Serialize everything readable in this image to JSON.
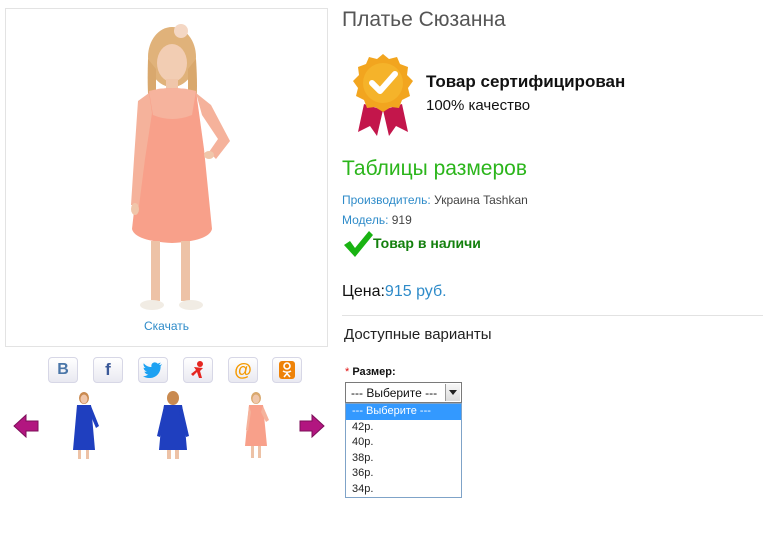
{
  "product": {
    "title": "Платье Сюзанна",
    "download_label": "Скачать"
  },
  "certificate": {
    "title": "Товар сертифицирован",
    "subtitle": "100% качество"
  },
  "size_tables_label": "Таблицы размеров",
  "meta": {
    "manufacturer_key": "Производитель:",
    "manufacturer_value": "Украина Tashkan",
    "model_key": "Модель:",
    "model_value": "919"
  },
  "stock_label": "Товар в наличи",
  "price": {
    "label": "Цена:",
    "value": "915 руб."
  },
  "variants": {
    "title": "Доступные варианты",
    "size_required_mark": "*",
    "size_label": "Размер:",
    "selected": "--- Выберите ---",
    "options": [
      "--- Выберите ---",
      "42р.",
      "40р.",
      "38р.",
      "36р.",
      "34р."
    ]
  },
  "social": [
    {
      "icon": "vk-icon",
      "glyph": "B",
      "color": "#4a76a8"
    },
    {
      "icon": "facebook-icon",
      "glyph": "f",
      "color": "#3b5998"
    },
    {
      "icon": "twitter-icon",
      "glyph": "🐦",
      "color": "#1da1f2"
    },
    {
      "icon": "yaru-icon",
      "glyph": "Я",
      "color": "#e52620"
    },
    {
      "icon": "mailru-icon",
      "glyph": "@",
      "color": "#f59a00"
    },
    {
      "icon": "odnoklassniki-icon",
      "glyph": "ок",
      "color": "#ee8208"
    }
  ],
  "colors": {
    "link": "#2e8bc9",
    "green": "#2bb51b",
    "dress_peach": "#f6a08b",
    "dress_blue": "#1f3fbf",
    "arrow": "#b21680"
  }
}
